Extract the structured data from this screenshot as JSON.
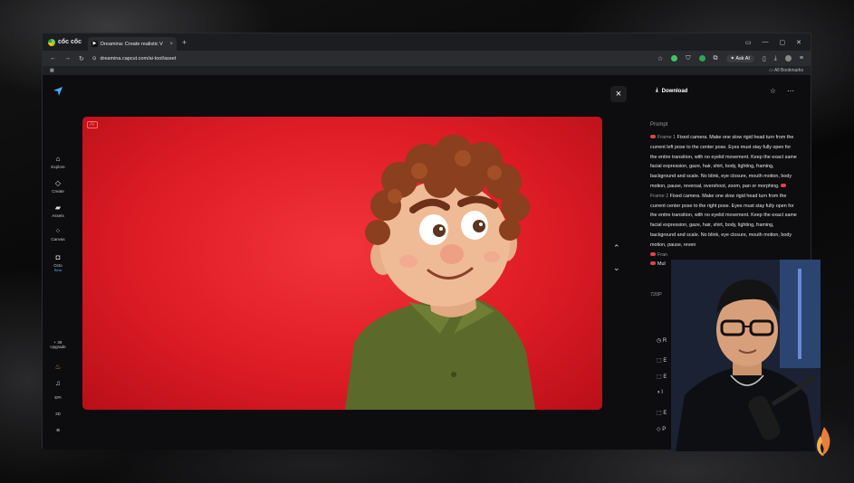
{
  "browser": {
    "brand": "cốc cốc",
    "tab_title": "Dreamina: Create realistic V",
    "tab_close": "×",
    "new_tab": "+",
    "url": "dreamina.capcut.com/ai-tool/asset",
    "ask_ai_label": "Ask AI",
    "all_bookmarks": "All Bookmarks",
    "window_controls": [
      "▭",
      "—",
      "▢",
      "✕"
    ]
  },
  "sidebar": {
    "items": [
      {
        "icon": "⌂",
        "label": "Explore"
      },
      {
        "icon": "◇",
        "label": "Create"
      },
      {
        "icon": "▰",
        "label": "Assets"
      },
      {
        "icon": "⁘",
        "label": "Canvas"
      },
      {
        "icon": "◘",
        "label": "Octo",
        "sub": "Beta"
      }
    ],
    "upgrade_count": "+ 39",
    "upgrade_label": "Upgrade",
    "bottom_items": [
      "EPI",
      "3D",
      "≡"
    ]
  },
  "media": {
    "ai_badge": "AI",
    "close_label": "×",
    "nav_up": "⌃",
    "nav_down": "⌄"
  },
  "panel": {
    "download_label": "Download",
    "prompt_label": "Prompt",
    "frame1_label": "Frame 1",
    "frame1_text": "Fixed camera. Make one slow rigid head turn from the current left pose to the center pose. Eyes must stay fully open for the entire transition, with no eyelid movement. Keep the exact same facial expression, gaze, hair, shirt, body, lighting, framing, background and scale. No blink, eye closure, mouth motion, body motion, pause, reversal, overshoot, zoom, pan or morphing.",
    "frame2_label": "Frame 2",
    "frame2_text": "Fixed camera. Make one slow rigid head turn from the current center pose to the right pose. Eyes must stay fully open for the entire transition, with no eyelid movement. Keep the exact same facial expression, gaze, hair, shirt, body, lighting, framing, background and scale. No blink, eye closure, mouth motion, body motion, pause, reven",
    "frame3_label": "Fran",
    "model_label": "Mul",
    "resolution": "720P",
    "options": [
      "R",
      "E",
      "E",
      "I",
      "E",
      "P"
    ]
  },
  "colors": {
    "accent_blue": "#46a8ff",
    "media_red": "#de1c26",
    "frame_tag_red": "#e24242"
  }
}
